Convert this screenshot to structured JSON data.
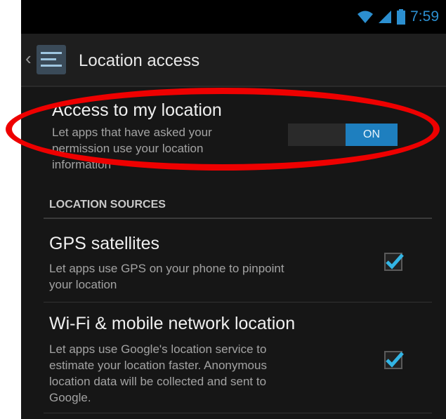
{
  "status_bar": {
    "time": "7:59"
  },
  "action_bar": {
    "title": "Location access"
  },
  "access": {
    "title": "Access to my location",
    "subtitle_line1": "Let apps that have asked your",
    "subtitle_line2": "permission use your location",
    "subtitle_line3": "information",
    "toggle_label": "ON"
  },
  "section": {
    "header": "LOCATION SOURCES"
  },
  "gps": {
    "title": "GPS satellites",
    "subtitle_line1": "Let apps use GPS on your phone to pinpoint",
    "subtitle_line2": "your location",
    "checked": true
  },
  "wifi": {
    "title": "Wi-Fi & mobile network location",
    "subtitle_line1": "Let apps use Google's location service to",
    "subtitle_line2": "estimate your location faster. Anonymous",
    "subtitle_line3": "location data will be collected and sent to",
    "subtitle_line4": "Google.",
    "checked": true
  },
  "colors": {
    "accent": "#33b5e5",
    "annotation": "#ee0000",
    "background": "#161616"
  }
}
